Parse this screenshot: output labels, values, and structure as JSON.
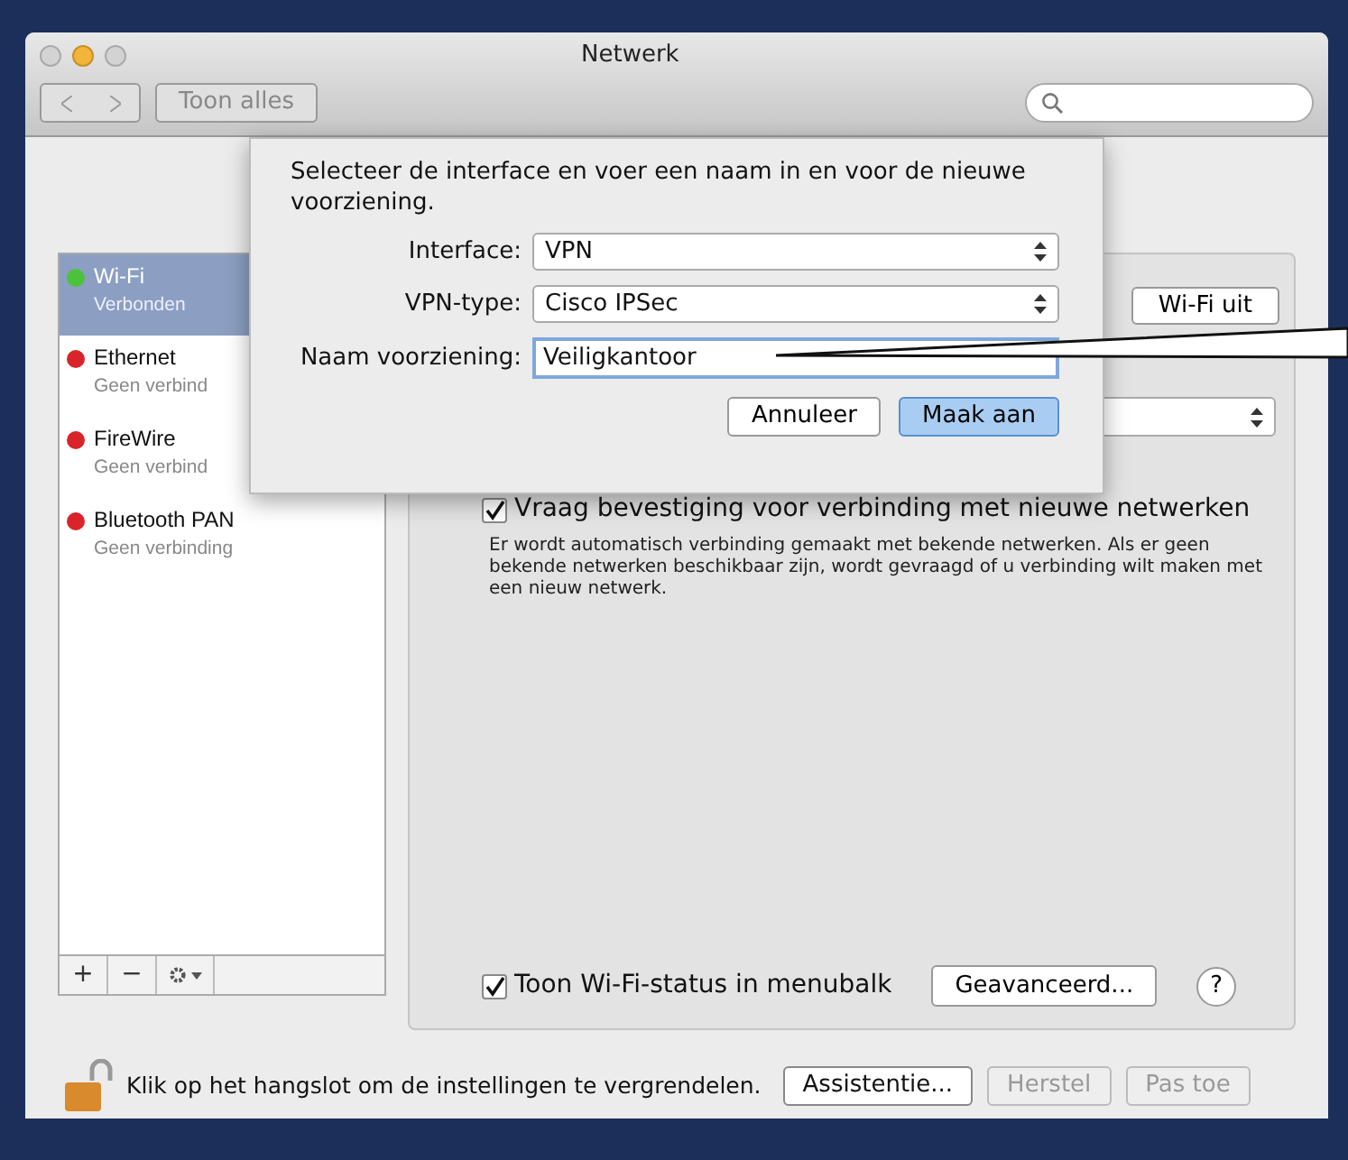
{
  "window": {
    "title": "Netwerk",
    "show_all": "Toon alles"
  },
  "services": [
    {
      "name": "Wi-Fi",
      "status": "Verbonden",
      "color": "#4cc23a",
      "selected": true
    },
    {
      "name": "Ethernet",
      "status": "Geen verbind",
      "color": "#d9242b",
      "selected": false
    },
    {
      "name": "FireWire",
      "status": "Geen verbind",
      "color": "#d9242b",
      "selected": false
    },
    {
      "name": "Bluetooth PAN",
      "status": "Geen verbinding",
      "color": "#d9242b",
      "selected": false
    }
  ],
  "list_buttons": [
    "+",
    "−"
  ],
  "panel": {
    "wifi_button": "Wi-Fi uit",
    "ask_checkbox": {
      "label": "Vraag bevestiging voor verbinding met nieuwe netwerken",
      "checked": true
    },
    "ask_note": "Er wordt automatisch verbinding gemaakt met bekende netwerken. Als er geen bekende netwerken beschikbaar zijn, wordt gevraagd of u verbinding wilt maken met een nieuw netwerk.",
    "status_checkbox": {
      "label": "Toon Wi-Fi-status in menubalk",
      "checked": true
    },
    "advanced": "Geavanceerd...",
    "help": "?"
  },
  "sheet": {
    "prompt": "Selecteer de interface en voer een naam in en voor de nieuwe voorziening.",
    "fields": [
      {
        "kind": "popup",
        "label": "Interface:",
        "value": "VPN"
      },
      {
        "kind": "popup",
        "label": "VPN-type:",
        "value": "Cisco IPSec"
      },
      {
        "kind": "text",
        "label": "Naam voorziening:",
        "value": "Veiligkantoor"
      }
    ],
    "buttons": [
      {
        "label": "Annuleer",
        "default": false
      },
      {
        "label": "Maak aan",
        "default": true
      }
    ]
  },
  "footer": {
    "lock_text": "Klik op het hangslot om de instellingen te vergrendelen.",
    "buttons": [
      {
        "label": "Assistentie...",
        "disabled": false
      },
      {
        "label": "Herstel",
        "disabled": true
      },
      {
        "label": "Pas toe",
        "disabled": true
      }
    ]
  }
}
